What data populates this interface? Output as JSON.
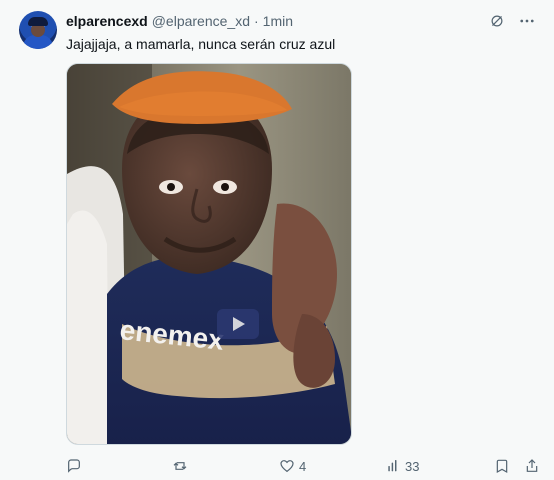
{
  "tweet": {
    "author_name": "elparencexd",
    "author_handle": "@elparence_xd",
    "separator": "·",
    "time": "1min",
    "text": "Jajajjaja, a mamarla, nunca serán cruz azul",
    "media_icon_name": "photo-image",
    "actions": {
      "reply_icon": "reply-icon",
      "retweet_icon": "retweet-icon",
      "like_icon": "heart-icon",
      "like_count": "4",
      "views_icon": "bar-chart-icon",
      "views_count": "33",
      "bookmark_icon": "bookmark-icon",
      "share_icon": "share-icon"
    },
    "top_icons": [
      "grok-icon",
      "more-icon"
    ]
  },
  "colors": {
    "background": "#f7f9f9",
    "text_primary": "#0f1419",
    "text_secondary": "#536471"
  }
}
